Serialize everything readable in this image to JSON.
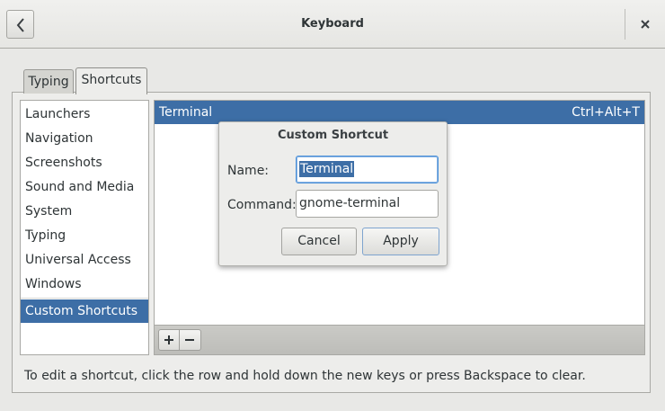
{
  "window": {
    "title": "Keyboard",
    "back_icon": "chevron-left-icon",
    "close_icon": "close-icon"
  },
  "tabs": [
    {
      "label": "Typing",
      "active": false
    },
    {
      "label": "Shortcuts",
      "active": true
    }
  ],
  "sidebar": {
    "items": [
      {
        "label": "Launchers"
      },
      {
        "label": "Navigation"
      },
      {
        "label": "Screenshots"
      },
      {
        "label": "Sound and Media"
      },
      {
        "label": "System"
      },
      {
        "label": "Typing"
      },
      {
        "label": "Universal Access"
      },
      {
        "label": "Windows"
      },
      {
        "label": "Custom Shortcuts",
        "selected": true
      }
    ]
  },
  "shortcuts": {
    "rows": [
      {
        "name": "Terminal",
        "accelerator": "Ctrl+Alt+T",
        "selected": true
      }
    ],
    "add_icon": "plus-icon",
    "remove_icon": "minus-icon"
  },
  "hint": "To edit a shortcut, click the row and hold down the new keys or press Backspace to clear.",
  "dialog": {
    "title": "Custom Shortcut",
    "name_label": "Name:",
    "name_value": "Terminal",
    "command_label": "Command:",
    "command_value": "gnome-terminal",
    "cancel_label": "Cancel",
    "apply_label": "Apply"
  },
  "colors": {
    "selection": "#3d6ea6",
    "focus_border": "#4a90d9"
  }
}
